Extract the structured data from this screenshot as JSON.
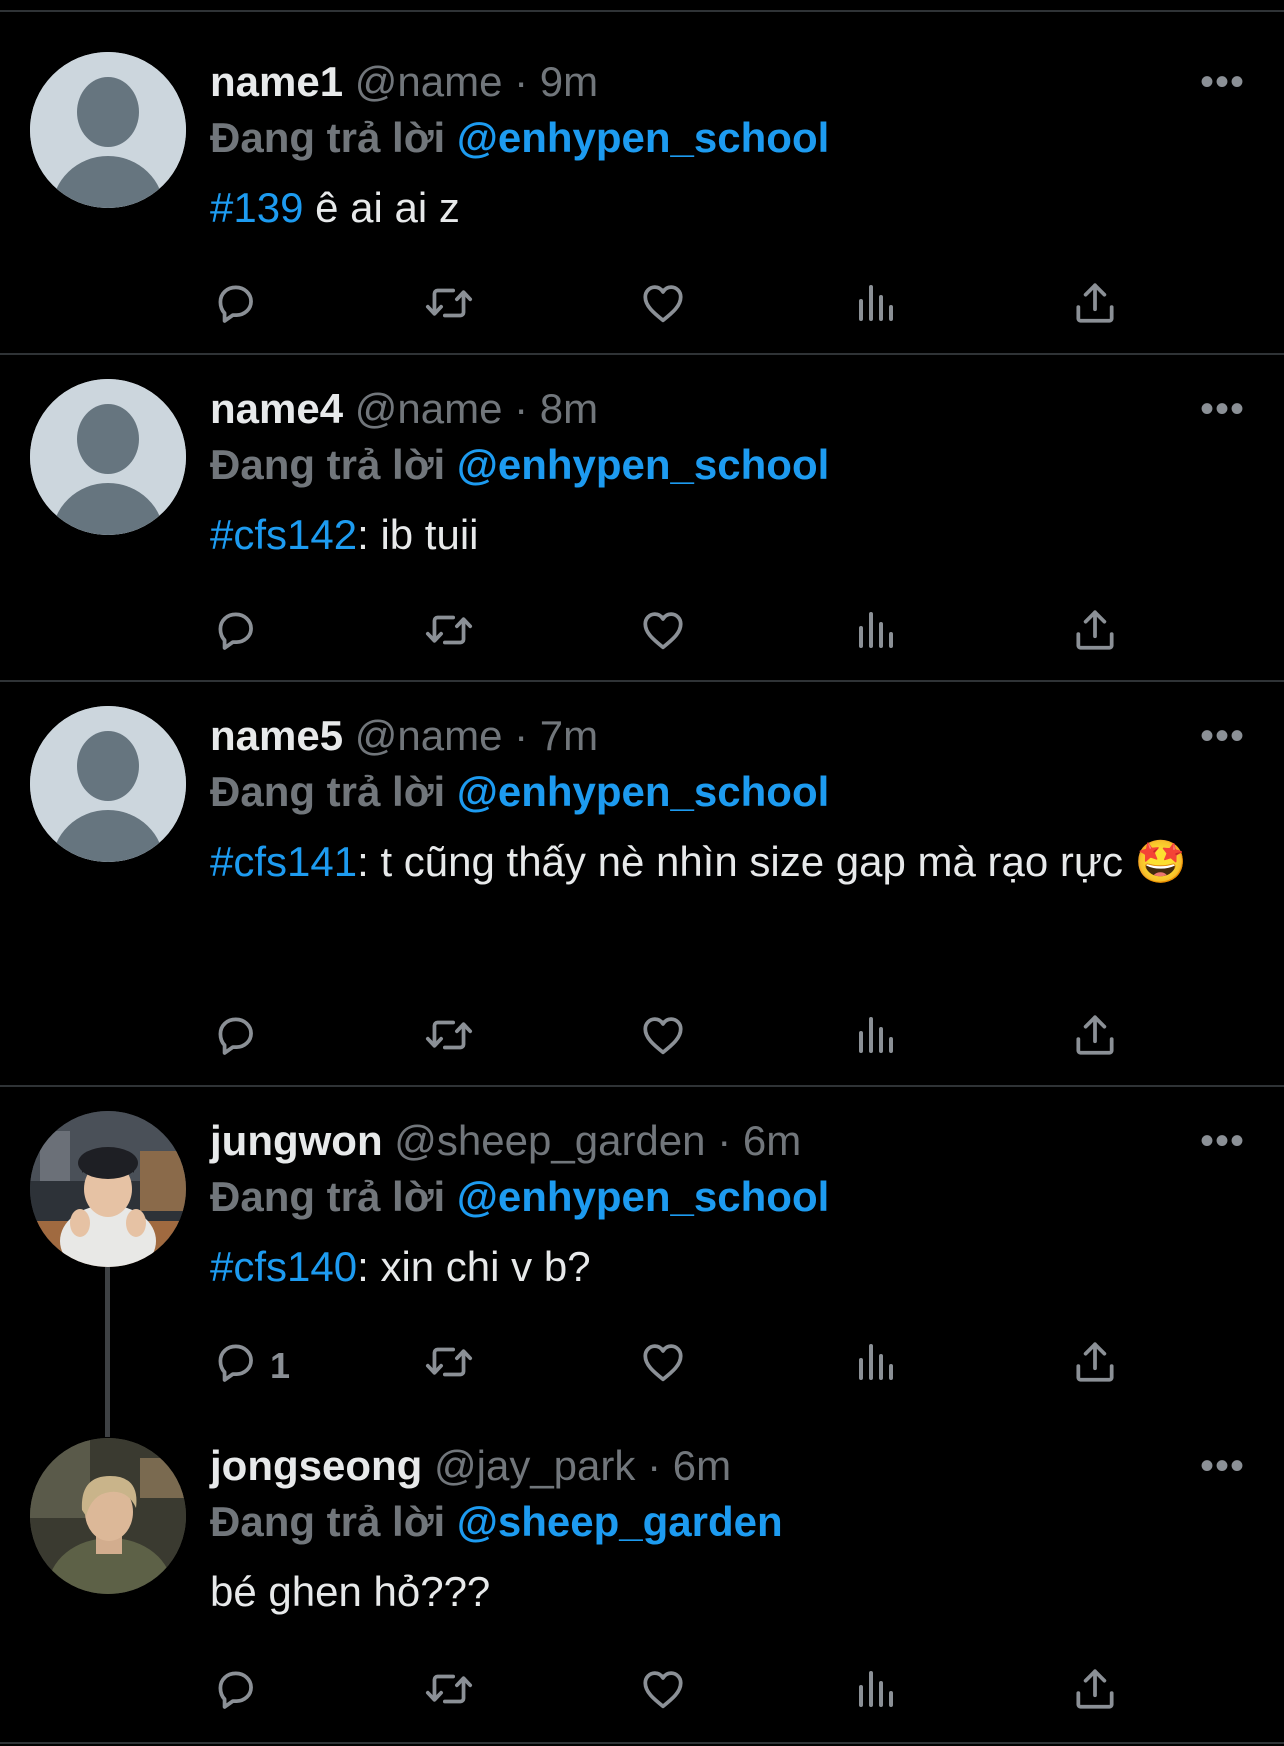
{
  "colors": {
    "background": "#000000",
    "accent": "#1d9bf0",
    "muted": "#71767b",
    "text": "#e7e9ea",
    "divider": "#2f3336"
  },
  "icons": [
    "reply-icon",
    "retweet-icon",
    "like-icon",
    "views-icon",
    "share-icon",
    "more-icon",
    "default-avatar-icon"
  ],
  "tweets": [
    {
      "name": "name1",
      "handle": "@name",
      "dot": "·",
      "time": "9m",
      "reply_prefix": "Đang trả lời",
      "reply_to": "@enhypen_school",
      "tag": "#139",
      "text": " ê ai ai z",
      "more": "•••",
      "reply_count": ""
    },
    {
      "name": "name4",
      "handle": "@name",
      "dot": "·",
      "time": "8m",
      "reply_prefix": "Đang trả lời",
      "reply_to": "@enhypen_school",
      "tag": "#cfs142",
      "text": ": ib tuii",
      "more": "•••",
      "reply_count": ""
    },
    {
      "name": "name5",
      "handle": "@name",
      "dot": "·",
      "time": "7m",
      "reply_prefix": "Đang trả lời",
      "reply_to": "@enhypen_school",
      "tag": "#cfs141",
      "text": ": t cũng thấy nè nhìn size gap mà rạo rực 🤩",
      "more": "•••",
      "reply_count": ""
    },
    {
      "name": "jungwon",
      "handle": "@sheep_garden",
      "dot": "·",
      "time": "6m",
      "reply_prefix": "Đang trả lời",
      "reply_to": "@enhypen_school",
      "tag": "#cfs140",
      "text": ": xin chi v b?",
      "more": "•••",
      "reply_count": "1"
    },
    {
      "name": "jongseong",
      "handle": "@jay_park",
      "dot": "·",
      "time": "6m",
      "reply_prefix": "Đang trả lời",
      "reply_to": "@sheep_garden",
      "tag": "",
      "text": "bé ghen hỏ???",
      "more": "•••",
      "reply_count": ""
    }
  ]
}
